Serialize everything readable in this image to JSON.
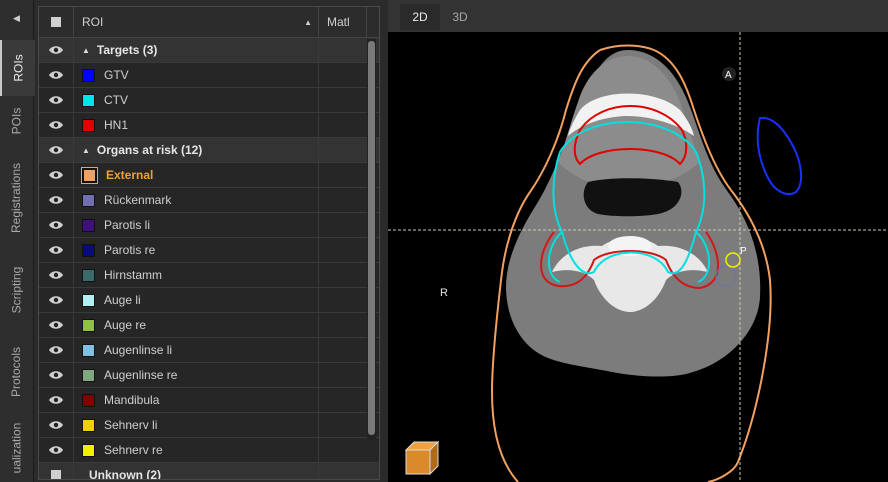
{
  "sidebar": {
    "collapse_icon": "triangle-left-icon",
    "tabs": [
      {
        "label": "ROIs",
        "active": true
      },
      {
        "label": "POIs",
        "active": false
      },
      {
        "label": "Registrations",
        "active": false
      },
      {
        "label": "Scripting",
        "active": false
      },
      {
        "label": "Protocols",
        "active": false
      },
      {
        "label": "ualization",
        "active": false
      }
    ]
  },
  "roi_table": {
    "columns": {
      "roi": "ROI",
      "matl": "Matl"
    },
    "groups": [
      {
        "label": "Targets (3)",
        "items": [
          {
            "name": "GTV",
            "color": "#0000ff"
          },
          {
            "name": "CTV",
            "color": "#00e5e5"
          },
          {
            "name": "HN1",
            "color": "#e00000"
          }
        ]
      },
      {
        "label": "Organs at risk (12)",
        "items": [
          {
            "name": "External",
            "color": "#f0a060",
            "highlighted": true
          },
          {
            "name": "Rückenmark",
            "color": "#7070b0"
          },
          {
            "name": "Parotis li",
            "color": "#40107a"
          },
          {
            "name": "Parotis re",
            "color": "#0a0a80"
          },
          {
            "name": "Hirnstamm",
            "color": "#3a6a6a"
          },
          {
            "name": "Auge li",
            "color": "#b0f0f0"
          },
          {
            "name": "Auge re",
            "color": "#90c040"
          },
          {
            "name": "Augenlinse li",
            "color": "#80c0e0"
          },
          {
            "name": "Augenlinse re",
            "color": "#80a880"
          },
          {
            "name": "Mandibula",
            "color": "#800000"
          },
          {
            "name": "Sehnerv li",
            "color": "#f0d000"
          },
          {
            "name": "Sehnerv re",
            "color": "#f0f000"
          }
        ]
      },
      {
        "label": "Unknown (2)",
        "items": []
      }
    ]
  },
  "viewer": {
    "tabs": [
      {
        "label": "2D",
        "active": true
      },
      {
        "label": "3D",
        "active": false
      }
    ],
    "orientation_right": "R",
    "orientation_anterior": "A",
    "poi_label": "P",
    "orientation_cube_icon": "orientation-cube-icon"
  }
}
